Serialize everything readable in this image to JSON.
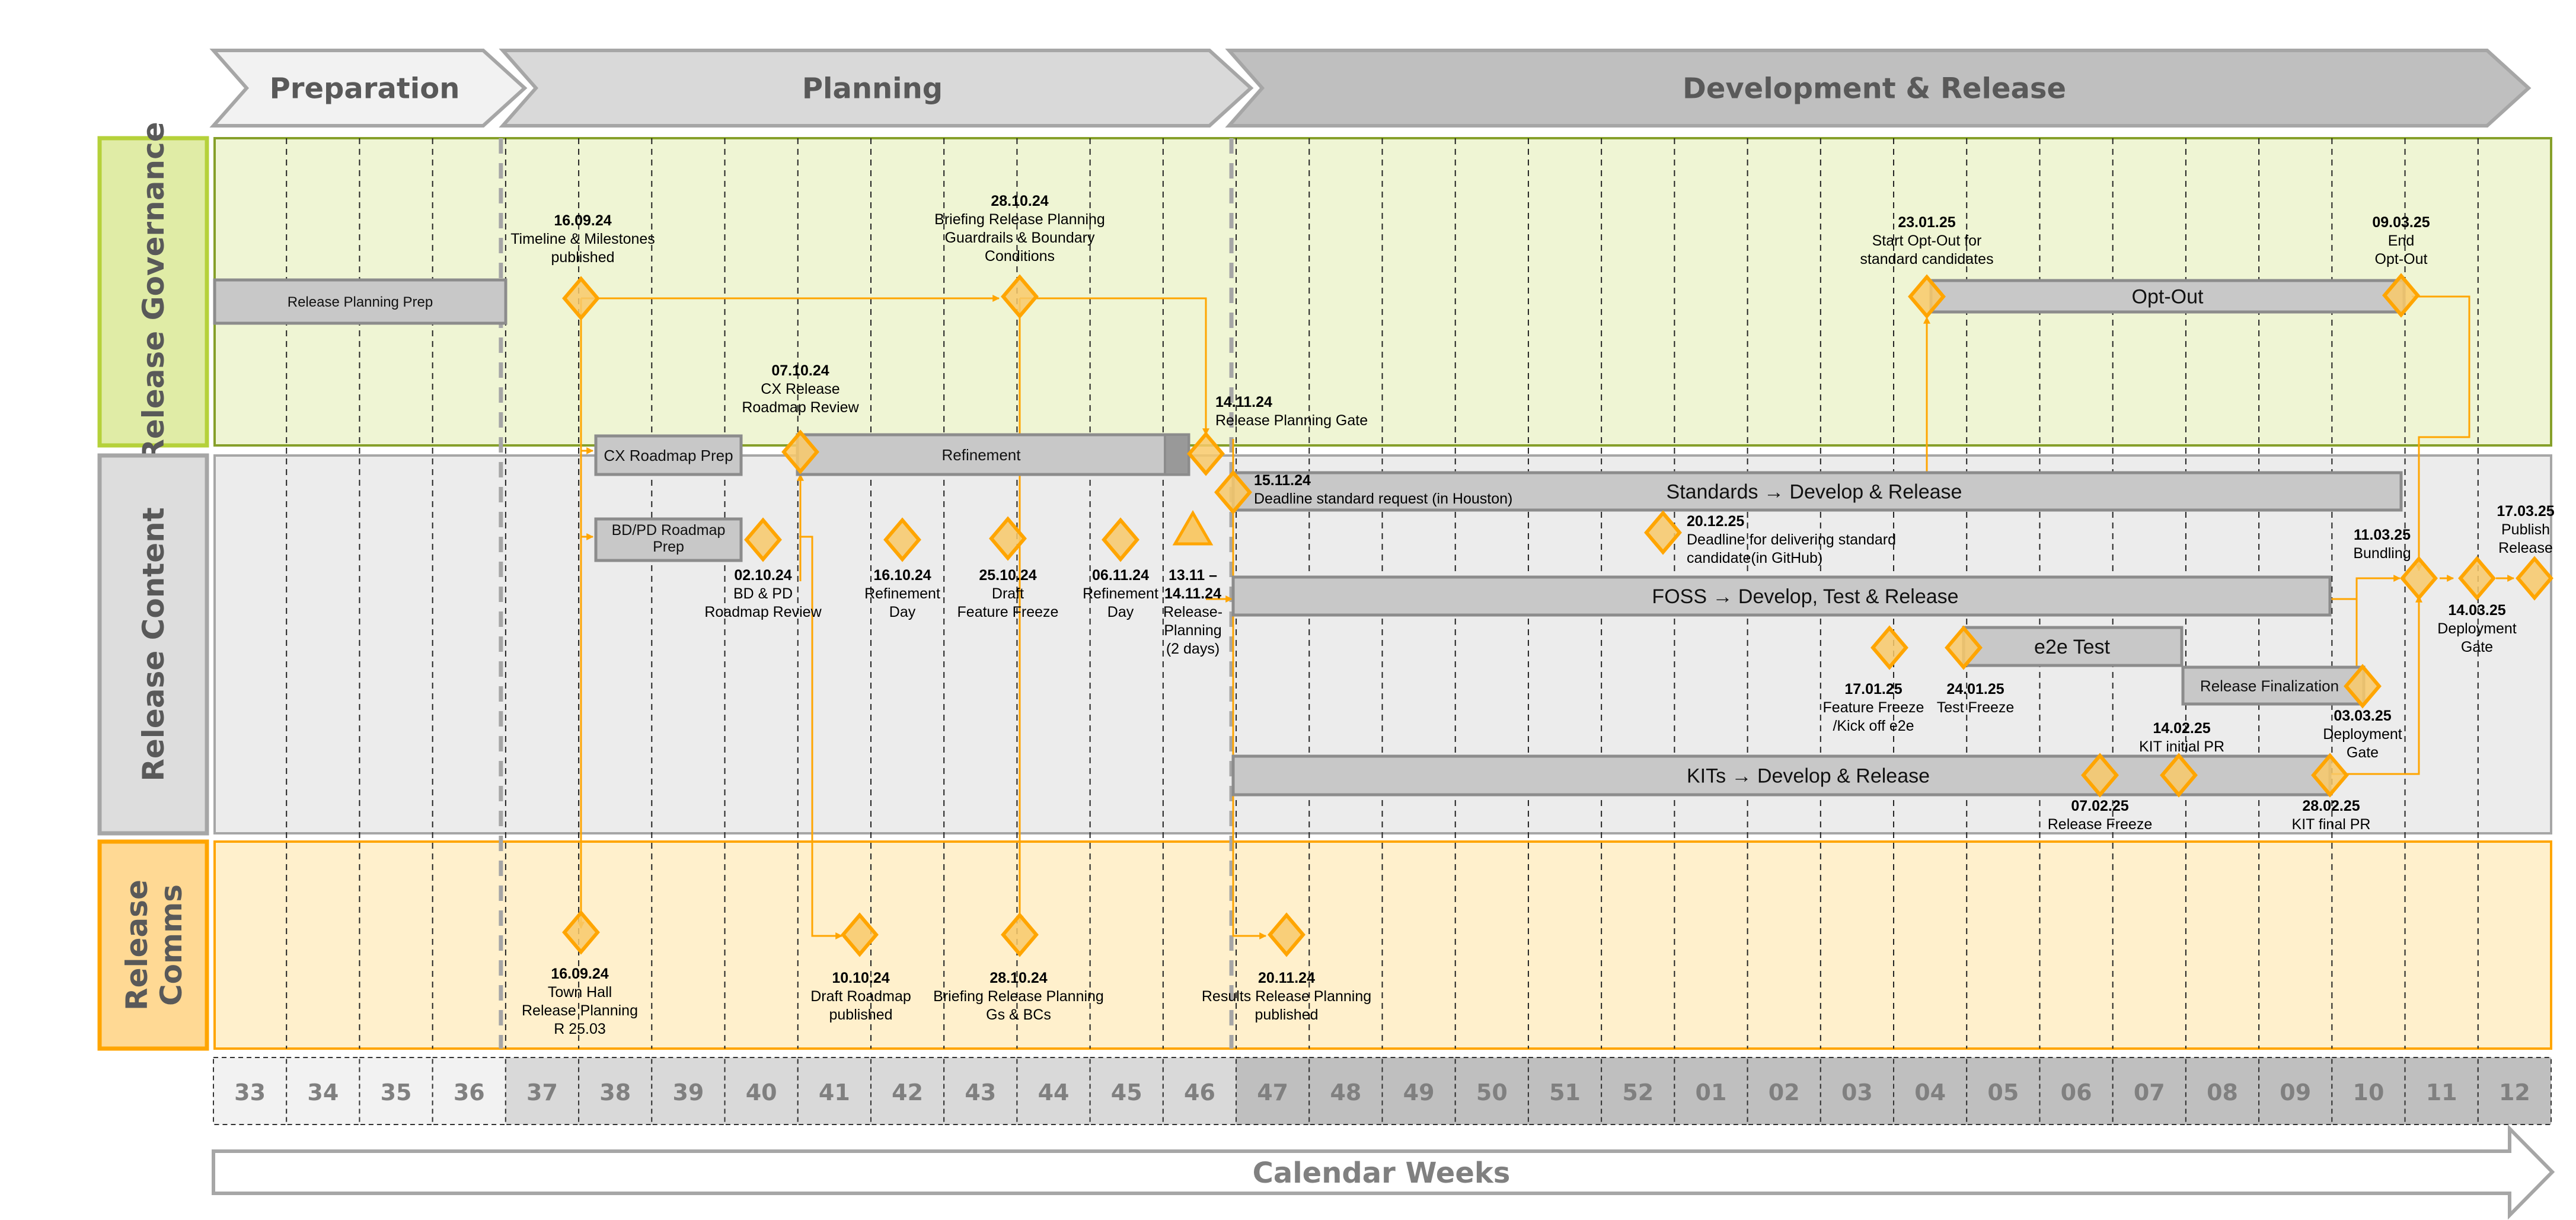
{
  "phases": [
    {
      "label": "Preparation",
      "weeks": [
        "33",
        "36"
      ],
      "fill": "#f2f2f2"
    },
    {
      "label": "Planning",
      "weeks": [
        "37",
        "46"
      ],
      "fill": "#d9d9d9"
    },
    {
      "label": "Development & Release",
      "weeks": [
        "47",
        "12"
      ],
      "fill": "#bfbfbf"
    }
  ],
  "lanes": [
    {
      "id": "governance",
      "label": "Release Governance",
      "fill": "#eff5d4",
      "label_fill": "#e0eca6",
      "border": "#b5d13a"
    },
    {
      "id": "content",
      "label": "Release Content",
      "fill": "#ececec",
      "label_fill": "#dddddd",
      "border": "#a6a6a6"
    },
    {
      "id": "comms",
      "label_lines": [
        "Release",
        "Comms"
      ],
      "fill": "#fff0cc",
      "label_fill": "#ffd994",
      "border": "#ffa500"
    }
  ],
  "weeks": [
    "33",
    "34",
    "35",
    "36",
    "37",
    "38",
    "39",
    "40",
    "41",
    "42",
    "43",
    "44",
    "45",
    "46",
    "47",
    "48",
    "49",
    "50",
    "51",
    "52",
    "01",
    "02",
    "03",
    "04",
    "05",
    "06",
    "07",
    "08",
    "09",
    "10",
    "11",
    "12"
  ],
  "axis_label": "Calendar Weeks",
  "colors": {
    "milestone_fill": "#f8c96a",
    "milestone_stroke": "#ffa500",
    "bar_fill": "#c8c8c8",
    "bar_stroke": "#8c8c8c",
    "connector": "#ffa500"
  },
  "bars": [
    {
      "id": "release-planning-prep",
      "label": "Release Planning Prep",
      "lane": "governance"
    },
    {
      "id": "cx-roadmap-prep",
      "label": "CX Roadmap Prep",
      "lane": "governance"
    },
    {
      "id": "refinement",
      "label": "Refinement",
      "lane": "governance"
    },
    {
      "id": "opt-out",
      "label": "Opt-Out",
      "lane": "governance"
    },
    {
      "id": "bdpd-roadmap-prep",
      "label_lines": [
        "BD/PD  Roadmap",
        "Prep"
      ],
      "lane": "content"
    },
    {
      "id": "standards",
      "label": "Standards → Develop & Release",
      "lane": "content"
    },
    {
      "id": "foss",
      "label": "FOSS → Develop, Test & Release",
      "lane": "content"
    },
    {
      "id": "e2e-test",
      "label": "e2e Test",
      "lane": "content"
    },
    {
      "id": "release-finalization",
      "label": "Release Finalization",
      "lane": "content"
    },
    {
      "id": "kits",
      "label": "KITs → Develop & Release",
      "lane": "content"
    }
  ],
  "milestones": [
    {
      "id": "m-160924-gov",
      "date": "16.09.24",
      "lines": [
        "Timeline & Milestones",
        "published"
      ],
      "lane": "governance"
    },
    {
      "id": "m-281024-gov",
      "date": "28.10.24",
      "lines": [
        "Briefing Release Planning",
        "Guardrails & Boundary",
        "Conditions"
      ],
      "lane": "governance"
    },
    {
      "id": "m-071024",
      "date": "07.10.24",
      "lines": [
        "CX Release",
        "Roadmap Review"
      ],
      "lane": "governance"
    },
    {
      "id": "m-141124",
      "date": "14.11.24",
      "lines": [
        "Release Planning Gate"
      ],
      "lane": "governance"
    },
    {
      "id": "m-230125",
      "date": "23.01.25",
      "lines": [
        "Start Opt-Out for",
        "standard candidates"
      ],
      "lane": "governance"
    },
    {
      "id": "m-090325",
      "date": "09.03.25",
      "lines": [
        "End",
        "Opt-Out"
      ],
      "lane": "governance"
    },
    {
      "id": "m-021024",
      "date": "02.10.24",
      "lines": [
        "BD & PD",
        "Roadmap Review"
      ],
      "lane": "content"
    },
    {
      "id": "m-161024",
      "date": "16.10.24",
      "lines": [
        "Refinement",
        "Day"
      ],
      "lane": "content"
    },
    {
      "id": "m-251024",
      "date": "25.10.24",
      "lines": [
        "Draft",
        "Feature Freeze"
      ],
      "lane": "content"
    },
    {
      "id": "m-061124",
      "date": "06.11.24",
      "lines": [
        "Refinement",
        "Day"
      ],
      "lane": "content"
    },
    {
      "id": "m-1311-141124",
      "date_lines": [
        "13.11 –",
        "14.11.24"
      ],
      "lines": [
        "Release-",
        "Planning",
        "(2 days)"
      ],
      "lane": "content",
      "shape": "triangle"
    },
    {
      "id": "m-151124",
      "date": "15.11.24",
      "lines": [
        "Deadline standard request (in  Houston)"
      ],
      "lane": "content"
    },
    {
      "id": "m-201225",
      "date": "20.12.25",
      "lines": [
        "Deadline for delivering standard",
        "candidate(in GitHub)"
      ],
      "lane": "content"
    },
    {
      "id": "m-170125",
      "date": "17.01.25",
      "lines": [
        "Feature Freeze",
        "/Kick off e2e"
      ],
      "lane": "content"
    },
    {
      "id": "m-240125",
      "date": "24.01.25",
      "lines": [
        "Test Freeze"
      ],
      "lane": "content"
    },
    {
      "id": "m-070225",
      "date": "07.02.25",
      "lines": [
        "Release Freeze"
      ],
      "lane": "content"
    },
    {
      "id": "m-140225",
      "date": "14.02.25",
      "lines": [
        "KIT initial PR"
      ],
      "lane": "content"
    },
    {
      "id": "m-280225",
      "date": "28.02.25",
      "lines": [
        "KIT final PR"
      ],
      "lane": "content"
    },
    {
      "id": "m-030325",
      "date": "03.03.25",
      "lines": [
        "Deployment",
        "Gate"
      ],
      "lane": "content"
    },
    {
      "id": "m-110325",
      "date": "11.03.25",
      "lines": [
        "Bundling"
      ],
      "lane": "content"
    },
    {
      "id": "m-140325",
      "date": "14.03.25",
      "lines": [
        "Deployment",
        "Gate"
      ],
      "lane": "content"
    },
    {
      "id": "m-170325",
      "date": "17.03.25",
      "lines": [
        "Publish",
        "Release"
      ],
      "lane": "content"
    },
    {
      "id": "m-160924-comms",
      "date": "16.09.24",
      "lines": [
        "Town Hall",
        "Release Planning",
        "R 25.03"
      ],
      "lane": "comms"
    },
    {
      "id": "m-101024",
      "date": "10.10.24",
      "lines": [
        "Draft Roadmap",
        "published"
      ],
      "lane": "comms"
    },
    {
      "id": "m-281024-comms",
      "date": "28.10.24",
      "lines": [
        "Briefing Release Planning",
        "Gs & BCs"
      ],
      "lane": "comms"
    },
    {
      "id": "m-201124",
      "date": "20.11.24",
      "lines": [
        "Results Release Planning",
        "published"
      ],
      "lane": "comms"
    }
  ]
}
